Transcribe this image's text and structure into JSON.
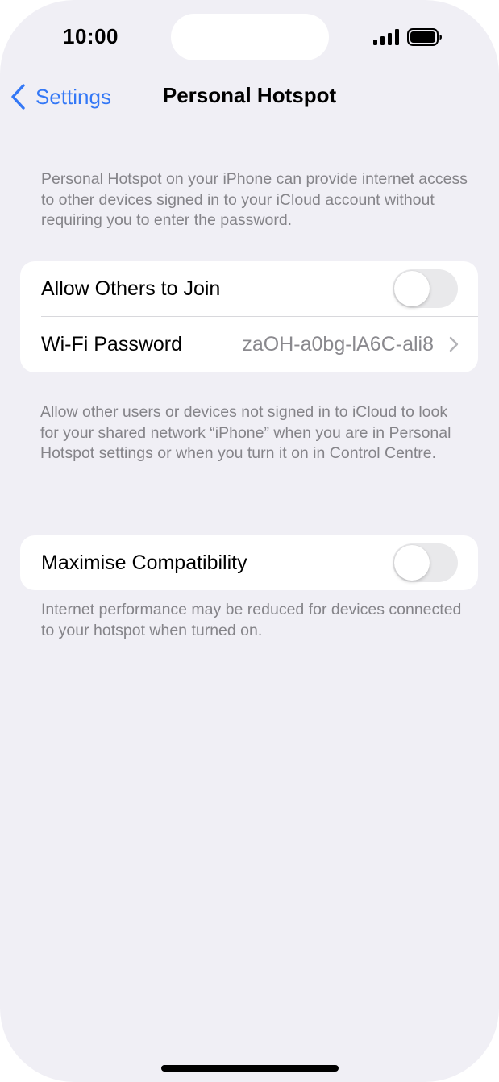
{
  "status_bar": {
    "time": "10:00",
    "icons": [
      "cellular-signal-icon",
      "battery-icon"
    ]
  },
  "nav": {
    "back_label": "Settings",
    "title": "Personal Hotspot",
    "back_icon": "chevron-left-icon"
  },
  "intro_note": "Personal Hotspot on your iPhone can provide internet access to other devices signed in to your iCloud account without requiring you to enter the password.",
  "group1": {
    "allow_others": {
      "label": "Allow Others to Join",
      "on": false
    },
    "wifi_password": {
      "label": "Wi-Fi Password",
      "value": "zaOH-a0bg-lA6C-ali8",
      "icon": "chevron-right-icon"
    }
  },
  "group1_footer": "Allow other users or devices not signed in to iCloud to look for your shared network “iPhone” when you are in Personal Hotspot settings or when you turn it on in Control Centre.",
  "group2": {
    "maximise": {
      "label": "Maximise Compatibility",
      "on": false
    }
  },
  "group2_footer": "Internet performance may be reduced for devices connected to your hotspot when turned on.",
  "colors": {
    "background": "#f0eff5",
    "accent": "#3478f6",
    "secondary_text": "#858489",
    "toggle_off": "#e9e9eb"
  }
}
